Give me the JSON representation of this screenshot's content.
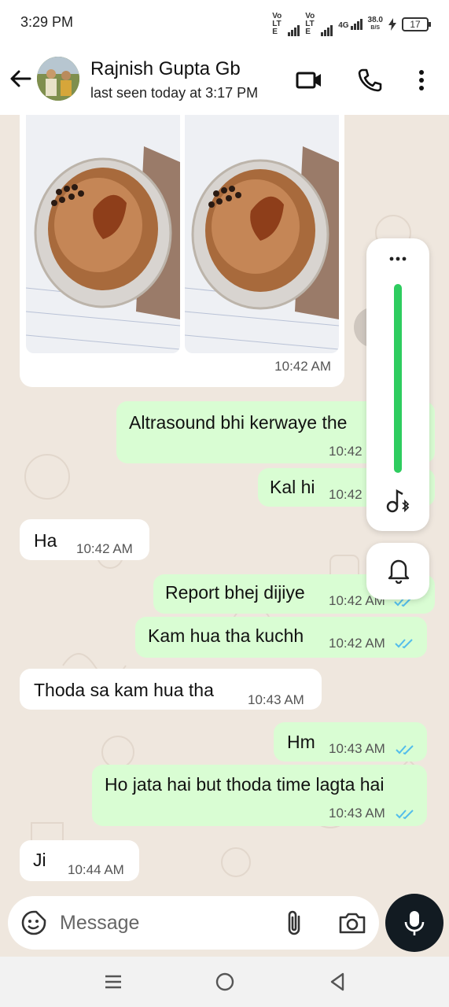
{
  "status_bar": {
    "time": "3:29 PM",
    "sim1_label": "Vo LTE",
    "sim2_label": "Vo LTE",
    "network": "4G",
    "speed_value": "38.0",
    "speed_unit": "B/S",
    "battery": "17"
  },
  "header": {
    "contact_name": "Rajnish Gupta Gb",
    "last_seen": "last seen today at 3:17 PM"
  },
  "messages": [
    {
      "direction": "in",
      "type": "images",
      "time": "10:42 AM"
    },
    {
      "direction": "out",
      "text": "Altrasound bhi kerwaye the",
      "time": "10:42"
    },
    {
      "direction": "out",
      "text": "Kal hi",
      "time": "10:42"
    },
    {
      "direction": "in",
      "text": "Ha",
      "time": "10:42 AM"
    },
    {
      "direction": "out",
      "text": "Report bhej dijiye",
      "time": "10:42 AM",
      "read": true
    },
    {
      "direction": "out",
      "text": "Kam hua tha kuchh",
      "time": "10:42 AM",
      "read": true
    },
    {
      "direction": "in",
      "text": "Thoda sa kam hua tha",
      "time": "10:43 AM"
    },
    {
      "direction": "out",
      "text": "Hm",
      "time": "10:43 AM",
      "read": true
    },
    {
      "direction": "out",
      "text": "Ho jata hai but thoda time lagta hai",
      "time": "10:43 AM",
      "read": true
    },
    {
      "direction": "in",
      "text": "Ji",
      "time": "10:44 AM"
    }
  ],
  "volume_panel": {
    "level": 1.0
  },
  "composer": {
    "placeholder": "Message"
  },
  "colors": {
    "outgoing_bubble": "#d9fdd3",
    "incoming_bubble": "#ffffff",
    "read_ticks": "#53bdeb",
    "volume_green": "#2ecc5f"
  }
}
